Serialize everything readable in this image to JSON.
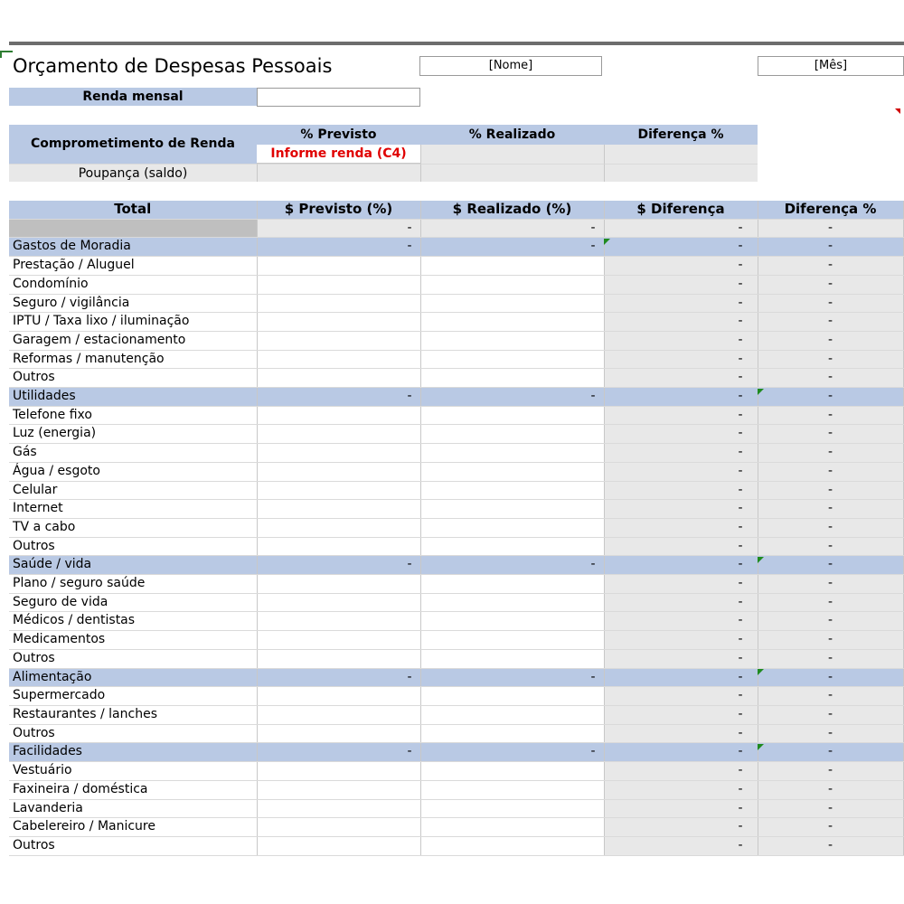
{
  "header": {
    "title": "Orçamento de Despesas Pessoais",
    "name_field": "[Nome]",
    "month_field": "[Mês]"
  },
  "income": {
    "label": "Renda mensal",
    "value": ""
  },
  "commitment": {
    "headers": [
      "Comprometimento de Renda",
      "% Previsto",
      "% Realizado",
      "Diferença %"
    ],
    "warning": "Informe renda (C4)",
    "warning_color": "#e00000",
    "savings_label": "Poupança (saldo)"
  },
  "budget": {
    "columns": [
      "Total",
      "$ Previsto (%)",
      "$ Realizado (%)",
      "$ Diferença",
      "Diferença %"
    ],
    "total_values": [
      "",
      "-",
      "-",
      "-",
      "-"
    ],
    "rows": [
      {
        "type": "category",
        "label": "Gastos de Moradia",
        "values": [
          "-",
          "-",
          "-",
          "-"
        ]
      },
      {
        "type": "item",
        "label": "Prestação / Aluguel",
        "values": [
          "",
          "",
          "-",
          "-"
        ]
      },
      {
        "type": "item",
        "label": "Condomínio",
        "values": [
          "",
          "",
          "-",
          "-"
        ]
      },
      {
        "type": "item",
        "label": "Seguro / vigilância",
        "values": [
          "",
          "",
          "-",
          "-"
        ]
      },
      {
        "type": "item",
        "label": "IPTU / Taxa lixo / iluminação",
        "values": [
          "",
          "",
          "-",
          "-"
        ]
      },
      {
        "type": "item",
        "label": "Garagem / estacionamento",
        "values": [
          "",
          "",
          "-",
          "-"
        ]
      },
      {
        "type": "item",
        "label": "Reformas / manutenção",
        "values": [
          "",
          "",
          "-",
          "-"
        ]
      },
      {
        "type": "item",
        "label": "Outros",
        "values": [
          "",
          "",
          "-",
          "-"
        ]
      },
      {
        "type": "category",
        "label": "Utilidades",
        "values": [
          "-",
          "-",
          "-",
          "-"
        ]
      },
      {
        "type": "item",
        "label": "Telefone fixo",
        "values": [
          "",
          "",
          "-",
          "-"
        ]
      },
      {
        "type": "item",
        "label": "Luz (energia)",
        "values": [
          "",
          "",
          "-",
          "-"
        ]
      },
      {
        "type": "item",
        "label": "Gás",
        "values": [
          "",
          "",
          "-",
          "-"
        ]
      },
      {
        "type": "item",
        "label": "Água / esgoto",
        "values": [
          "",
          "",
          "-",
          "-"
        ]
      },
      {
        "type": "item",
        "label": "Celular",
        "values": [
          "",
          "",
          "-",
          "-"
        ]
      },
      {
        "type": "item",
        "label": "Internet",
        "values": [
          "",
          "",
          "-",
          "-"
        ]
      },
      {
        "type": "item",
        "label": "TV a cabo",
        "values": [
          "",
          "",
          "-",
          "-"
        ]
      },
      {
        "type": "item",
        "label": "Outros",
        "values": [
          "",
          "",
          "-",
          "-"
        ]
      },
      {
        "type": "category",
        "label": "Saúde / vida",
        "values": [
          "-",
          "-",
          "-",
          "-"
        ]
      },
      {
        "type": "item",
        "label": "Plano / seguro saúde",
        "values": [
          "",
          "",
          "-",
          "-"
        ]
      },
      {
        "type": "item",
        "label": "Seguro de vida",
        "values": [
          "",
          "",
          "-",
          "-"
        ]
      },
      {
        "type": "item",
        "label": "Médicos / dentistas",
        "values": [
          "",
          "",
          "-",
          "-"
        ]
      },
      {
        "type": "item",
        "label": "Medicamentos",
        "values": [
          "",
          "",
          "-",
          "-"
        ]
      },
      {
        "type": "item",
        "label": "Outros",
        "values": [
          "",
          "",
          "-",
          "-"
        ]
      },
      {
        "type": "category",
        "label": "Alimentação",
        "values": [
          "-",
          "-",
          "-",
          "-"
        ]
      },
      {
        "type": "item",
        "label": "Supermercado",
        "values": [
          "",
          "",
          "-",
          "-"
        ]
      },
      {
        "type": "item",
        "label": "Restaurantes / lanches",
        "values": [
          "",
          "",
          "-",
          "-"
        ]
      },
      {
        "type": "item",
        "label": "Outros",
        "values": [
          "",
          "",
          "-",
          "-"
        ]
      },
      {
        "type": "category",
        "label": "Facilidades",
        "values": [
          "-",
          "-",
          "-",
          "-"
        ]
      },
      {
        "type": "item",
        "label": "Vestuário",
        "values": [
          "",
          "",
          "-",
          "-"
        ]
      },
      {
        "type": "item",
        "label": "Faxineira / doméstica",
        "values": [
          "",
          "",
          "-",
          "-"
        ]
      },
      {
        "type": "item",
        "label": "Lavanderia",
        "values": [
          "",
          "",
          "-",
          "-"
        ]
      },
      {
        "type": "item",
        "label": "Cabelereiro / Manicure",
        "values": [
          "",
          "",
          "-",
          "-"
        ]
      },
      {
        "type": "item",
        "label": "Outros",
        "values": [
          "",
          "",
          "-",
          "-"
        ]
      }
    ]
  },
  "colors": {
    "header_fill": "#b9c9e4",
    "calc_fill": "#e8e8e8",
    "total_fill": "#bfbfbf",
    "note_marker": "#1f8a1f",
    "comment_marker": "#d00000"
  }
}
